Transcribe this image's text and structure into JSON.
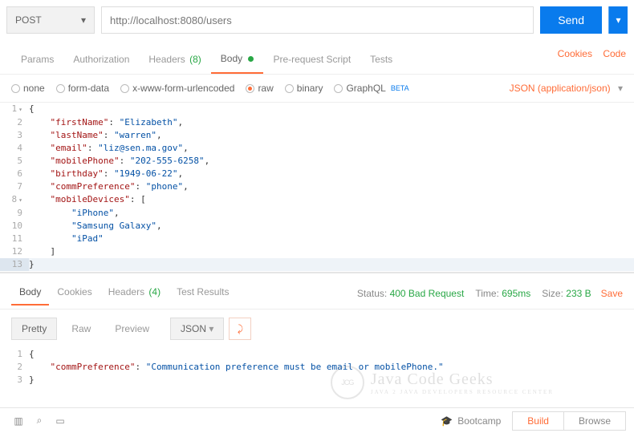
{
  "request": {
    "method": "POST",
    "url": "http://localhost:8080/users",
    "send_label": "Send"
  },
  "tabs": {
    "params": "Params",
    "authorization": "Authorization",
    "headers": "Headers",
    "headers_count": "(8)",
    "body": "Body",
    "prerequest": "Pre-request Script",
    "tests": "Tests",
    "cookies_link": "Cookies",
    "code_link": "Code"
  },
  "body_types": {
    "none": "none",
    "form_data": "form-data",
    "urlencoded": "x-www-form-urlencoded",
    "raw": "raw",
    "binary": "binary",
    "graphql": "GraphQL",
    "graphql_beta": "BETA",
    "content_type": "JSON (application/json)"
  },
  "request_body_json": {
    "firstName": "Elizabeth",
    "lastName": "warren",
    "email": "liz@sen.ma.gov",
    "mobilePhone": "202-555-6258",
    "birthday": "1949-06-22",
    "commPreference": "phone",
    "mobileDevices": [
      "iPhone",
      "Samsung Galaxy",
      "iPad"
    ]
  },
  "editor_lines": [
    {
      "n": "1",
      "fold": true,
      "ind": 0,
      "tokens": [
        {
          "t": "punc",
          "v": "{"
        }
      ]
    },
    {
      "n": "2",
      "ind": 1,
      "tokens": [
        {
          "t": "key",
          "v": "\"firstName\""
        },
        {
          "t": "punc",
          "v": ": "
        },
        {
          "t": "str",
          "v": "\"Elizabeth\""
        },
        {
          "t": "punc",
          "v": ","
        }
      ]
    },
    {
      "n": "3",
      "ind": 1,
      "tokens": [
        {
          "t": "key",
          "v": "\"lastName\""
        },
        {
          "t": "punc",
          "v": ": "
        },
        {
          "t": "str",
          "v": "\"warren\""
        },
        {
          "t": "punc",
          "v": ","
        }
      ]
    },
    {
      "n": "4",
      "ind": 1,
      "tokens": [
        {
          "t": "key",
          "v": "\"email\""
        },
        {
          "t": "punc",
          "v": ": "
        },
        {
          "t": "str",
          "v": "\"liz@sen.ma.gov\""
        },
        {
          "t": "punc",
          "v": ","
        }
      ]
    },
    {
      "n": "5",
      "ind": 1,
      "tokens": [
        {
          "t": "key",
          "v": "\"mobilePhone\""
        },
        {
          "t": "punc",
          "v": ": "
        },
        {
          "t": "str",
          "v": "\"202-555-6258\""
        },
        {
          "t": "punc",
          "v": ","
        }
      ]
    },
    {
      "n": "6",
      "ind": 1,
      "tokens": [
        {
          "t": "key",
          "v": "\"birthday\""
        },
        {
          "t": "punc",
          "v": ": "
        },
        {
          "t": "str",
          "v": "\"1949-06-22\""
        },
        {
          "t": "punc",
          "v": ","
        }
      ]
    },
    {
      "n": "7",
      "ind": 1,
      "tokens": [
        {
          "t": "key",
          "v": "\"commPreference\""
        },
        {
          "t": "punc",
          "v": ": "
        },
        {
          "t": "str",
          "v": "\"phone\""
        },
        {
          "t": "punc",
          "v": ","
        }
      ]
    },
    {
      "n": "8",
      "fold": true,
      "ind": 1,
      "tokens": [
        {
          "t": "key",
          "v": "\"mobileDevices\""
        },
        {
          "t": "punc",
          "v": ": ["
        }
      ]
    },
    {
      "n": "9",
      "ind": 2,
      "tokens": [
        {
          "t": "str",
          "v": "\"iPhone\""
        },
        {
          "t": "punc",
          "v": ","
        }
      ]
    },
    {
      "n": "10",
      "ind": 2,
      "tokens": [
        {
          "t": "str",
          "v": "\"Samsung Galaxy\""
        },
        {
          "t": "punc",
          "v": ","
        }
      ]
    },
    {
      "n": "11",
      "ind": 2,
      "tokens": [
        {
          "t": "str",
          "v": "\"iPad\""
        }
      ]
    },
    {
      "n": "12",
      "ind": 1,
      "tokens": [
        {
          "t": "punc",
          "v": "]"
        }
      ]
    },
    {
      "n": "13",
      "ind": 0,
      "active": true,
      "tokens": [
        {
          "t": "punc",
          "v": "} "
        }
      ]
    }
  ],
  "response": {
    "tabs": {
      "body": "Body",
      "cookies": "Cookies",
      "headers": "Headers",
      "headers_count": "(4)",
      "tests": "Test Results"
    },
    "status_label": "Status:",
    "status_val": "400 Bad Request",
    "time_label": "Time:",
    "time_val": "695ms",
    "size_label": "Size:",
    "size_val": "233 B",
    "save": "Save",
    "controls": {
      "pretty": "Pretty",
      "raw": "Raw",
      "preview": "Preview",
      "format": "JSON"
    },
    "body_json": {
      "commPreference": "Communication preference must be email or mobilePhone."
    },
    "lines": [
      {
        "n": "1",
        "ind": 0,
        "tokens": [
          {
            "t": "punc",
            "v": "{"
          }
        ]
      },
      {
        "n": "2",
        "ind": 1,
        "tokens": [
          {
            "t": "key",
            "v": "\"commPreference\""
          },
          {
            "t": "punc",
            "v": ": "
          },
          {
            "t": "str",
            "v": "\"Communication preference must be email or mobilePhone.\""
          }
        ]
      },
      {
        "n": "3",
        "ind": 0,
        "tokens": [
          {
            "t": "punc",
            "v": "}"
          }
        ]
      }
    ]
  },
  "footer": {
    "bootcamp": "Bootcamp",
    "build": "Build",
    "browse": "Browse"
  },
  "watermark": {
    "logo": "JCG",
    "title": "Java Code Geeks",
    "sub": "JAVA 2 JAVA DEVELOPERS RESOURCE CENTER"
  }
}
